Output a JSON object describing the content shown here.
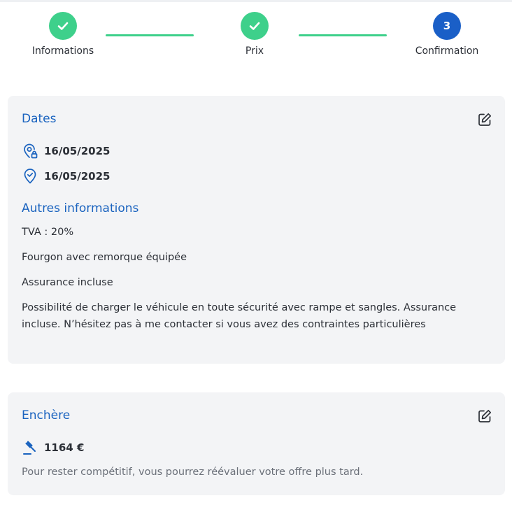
{
  "stepper": {
    "steps": [
      {
        "label": "Informations",
        "state": "done"
      },
      {
        "label": "Prix",
        "state": "done"
      },
      {
        "label": "Confirmation",
        "state": "current",
        "number": "3"
      }
    ]
  },
  "dates_card": {
    "title": "Dates",
    "start_date": "16/05/2025",
    "end_date": "16/05/2025",
    "other_title": "Autres informations",
    "vat": "TVA : 20%",
    "vehicle": "Fourgon avec remorque équipée",
    "insurance": "Assurance incluse",
    "description": "Possibilité de charger le véhicule en toute sécurité avec rampe et sangles. Assurance incluse. N’hésitez pas à me contacter si vous avez des contraintes particulières"
  },
  "bid_card": {
    "title": "Enchère",
    "amount": "1164 €",
    "note": "Pour rester compétitif, vous pourrez réévaluer votre offre plus tard."
  },
  "colors": {
    "accent": "#1a63bf",
    "step_done": "#3ed08b",
    "step_current": "#1a5fc7",
    "card_bg": "#f3f4f6"
  }
}
